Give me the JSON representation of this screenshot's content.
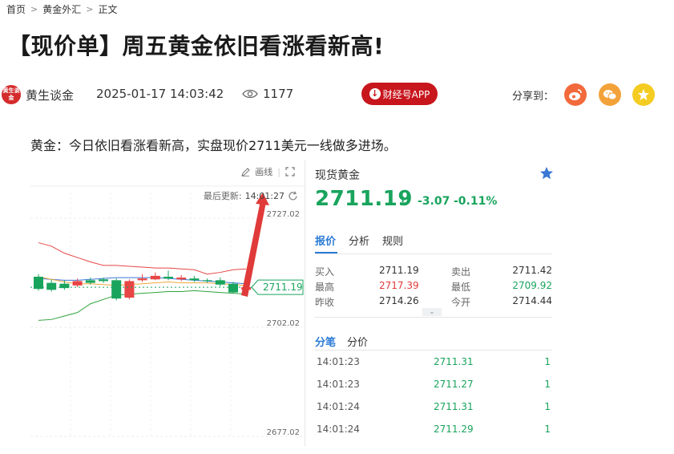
{
  "breadcrumb": {
    "items": [
      "首页",
      "黄金外汇",
      "正文"
    ],
    "separator": ">"
  },
  "article": {
    "title": "【现价单】周五黄金依旧看涨看新高!",
    "lead": "黄金：今日依旧看涨看新高，实盘现价2711美元一线做多进场。"
  },
  "meta": {
    "avatar_text": "黄生谈金",
    "author": "黄生谈金",
    "time": "2025-01-17 14:03:42",
    "views": "1177",
    "app_button": "财经号APP",
    "share_label": "分享到：",
    "icons": [
      "eye-icon",
      "download-icon",
      "weibo-icon",
      "wechat-icon",
      "star-icon"
    ]
  },
  "chart": {
    "toolbar_draw": "画线",
    "update_label": "最后更新:",
    "update_time": "14:01:27",
    "current_label": "2711.19",
    "y_ticks": [
      "2727.02",
      "2702.02",
      "2677.02"
    ],
    "colors": {
      "up": "#e84545",
      "down": "#19a45d",
      "upper_band": "#e84545",
      "lower_band": "#2fa33c",
      "ma_blue": "#3a78d4",
      "ma_orange": "#f1a93a",
      "arrow": "#e03a3a"
    }
  },
  "chart_data": {
    "type": "candlestick",
    "title": "",
    "ylim": [
      2677.02,
      2727.02
    ],
    "y_ticks": [
      2727.02,
      2702.02,
      2677.02
    ],
    "current_price": 2711.19,
    "candles": [
      {
        "open": 2713.6,
        "close": 2710.8,
        "high": 2714.2,
        "low": 2710.4
      },
      {
        "open": 2712.2,
        "close": 2710.6,
        "high": 2713.0,
        "low": 2710.2
      },
      {
        "open": 2712.0,
        "close": 2711.0,
        "high": 2712.8,
        "low": 2710.6
      },
      {
        "open": 2711.6,
        "close": 2712.6,
        "high": 2713.2,
        "low": 2711.2
      },
      {
        "open": 2712.8,
        "close": 2712.2,
        "high": 2713.4,
        "low": 2711.8
      },
      {
        "open": 2713.0,
        "close": 2712.6,
        "high": 2713.4,
        "low": 2712.2
      },
      {
        "open": 2712.8,
        "close": 2708.6,
        "high": 2713.2,
        "low": 2708.2
      },
      {
        "open": 2708.8,
        "close": 2712.6,
        "high": 2713.0,
        "low": 2708.4
      },
      {
        "open": 2712.8,
        "close": 2713.2,
        "high": 2714.2,
        "low": 2712.4
      },
      {
        "open": 2713.0,
        "close": 2713.8,
        "high": 2714.6,
        "low": 2712.8
      },
      {
        "open": 2713.6,
        "close": 2713.2,
        "high": 2715.0,
        "low": 2712.8
      },
      {
        "open": 2713.0,
        "close": 2713.4,
        "high": 2714.0,
        "low": 2712.6
      },
      {
        "open": 2713.2,
        "close": 2712.8,
        "high": 2713.8,
        "low": 2712.4
      },
      {
        "open": 2712.8,
        "close": 2712.6,
        "high": 2713.2,
        "low": 2712.2
      },
      {
        "open": 2712.8,
        "close": 2711.8,
        "high": 2713.4,
        "low": 2711.4
      },
      {
        "open": 2712.0,
        "close": 2710.0,
        "high": 2712.4,
        "low": 2709.8
      },
      {
        "open": 2710.6,
        "close": 2711.2,
        "high": 2711.6,
        "low": 2710.2
      }
    ],
    "upper_band": [
      2721.4,
      2720.6,
      2719.0,
      2718.0,
      2717.0,
      2716.2,
      2716.2,
      2716.0,
      2715.8,
      2715.6,
      2715.6,
      2715.4,
      2715.2,
      2714.2,
      2714.6,
      2715.2,
      2715.4
    ],
    "lower_band": [
      2703.6,
      2703.8,
      2704.6,
      2705.4,
      2707.4,
      2708.4,
      2709.4,
      2709.6,
      2709.8,
      2710.0,
      2710.2,
      2710.2,
      2710.4,
      2710.2,
      2710.0,
      2709.8,
      2709.6
    ],
    "ma_blue": [
      2713.2,
      2713.0,
      2712.8,
      2712.8,
      2713.0,
      2713.2,
      2713.4,
      2713.4,
      2713.4,
      2713.4,
      2713.2,
      2713.0,
      2712.8,
      2712.6,
      2712.4,
      2712.2,
      2712.0
    ],
    "ma_orange": [
      2713.6,
      2713.0,
      2712.4,
      2712.0,
      2712.0,
      2711.8,
      2711.6,
      2711.8,
      2712.0,
      2712.2,
      2712.4,
      2712.2,
      2712.2,
      2712.2,
      2712.0,
      2711.8,
      2711.6
    ]
  },
  "quote": {
    "name": "现货黄金",
    "price": "2711.19",
    "arrow": "↓",
    "change": "-3.07",
    "change_pct": "-0.11%",
    "tabs": [
      "报价",
      "分析",
      "规则"
    ],
    "stats": [
      {
        "l1": "买入",
        "v1": "2711.19",
        "c1": "",
        "l2": "卖出",
        "v2": "2711.42",
        "c2": ""
      },
      {
        "l1": "最高",
        "v1": "2717.39",
        "c1": "red",
        "l2": "最低",
        "v2": "2709.92",
        "c2": "green"
      },
      {
        "l1": "昨收",
        "v1": "2714.26",
        "c1": "",
        "l2": "今开",
        "v2": "2714.44",
        "c2": ""
      }
    ],
    "tabs2": [
      "分笔",
      "分价"
    ],
    "ticks": [
      {
        "time": "14:01:23",
        "price": "2711.31",
        "vol": "1"
      },
      {
        "time": "14:01:23",
        "price": "2711.27",
        "vol": "1"
      },
      {
        "time": "14:01:24",
        "price": "2711.31",
        "vol": "1"
      },
      {
        "time": "14:01:24",
        "price": "2711.29",
        "vol": "1"
      }
    ]
  }
}
